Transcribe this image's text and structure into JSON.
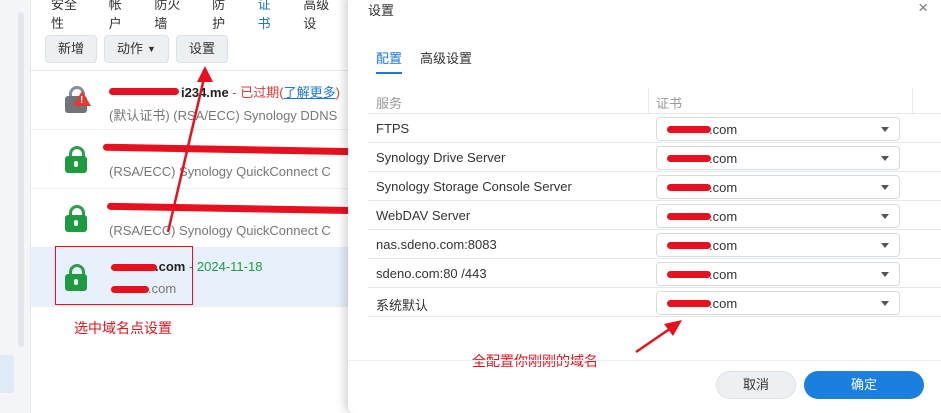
{
  "bg": {
    "tabs": [
      "安全性",
      "帐户",
      "防火墙",
      "防护",
      "证书",
      "高级设"
    ],
    "active_tab": "证书",
    "toolbar": {
      "new_label": "新增",
      "action_label": "动作",
      "settings_label": "设置"
    },
    "certs": [
      {
        "name_visible": "i234.me",
        "sep": " - ",
        "status": "已过期",
        "learn_open": "(",
        "learn": "了解更多",
        "learn_close": ")",
        "sub": "(默认证书) (RSA/ECC) Synology DDNS"
      },
      {
        "sub": "(RSA/ECC) Synology QuickConnect C"
      },
      {
        "sub": "(RSA/ECC) Synology QuickConnect C"
      },
      {
        "name_visible": ".com",
        "sep": " - ",
        "date": "2024-11-18",
        "sub": ".com"
      }
    ],
    "annotation_select": "选中域名点设置"
  },
  "dialog": {
    "title": "设置",
    "close": "×",
    "tabs": [
      "配置",
      "高级设置"
    ],
    "col_service": "服务",
    "col_cert": "证书",
    "rows": [
      {
        "service": "FTPS",
        "cert": ".com"
      },
      {
        "service": "Synology Drive Server",
        "cert": ".com"
      },
      {
        "service": "Synology Storage Console Server",
        "cert": ".com"
      },
      {
        "service": "WebDAV Server",
        "cert": ".com"
      },
      {
        "service": "nas.sdeno.com:8083",
        "cert": ".com"
      },
      {
        "service": "sdeno.com:80 /443",
        "cert": ".com"
      },
      {
        "service": "系统默认",
        "cert": ".com"
      }
    ],
    "annotation_all": "全配置你刚刚的域名",
    "cancel_label": "取消",
    "ok_label": "确定"
  },
  "colors": {
    "accent": "#1a78d6",
    "annotation": "#e8101e",
    "lock_green": "#1e9b40"
  }
}
